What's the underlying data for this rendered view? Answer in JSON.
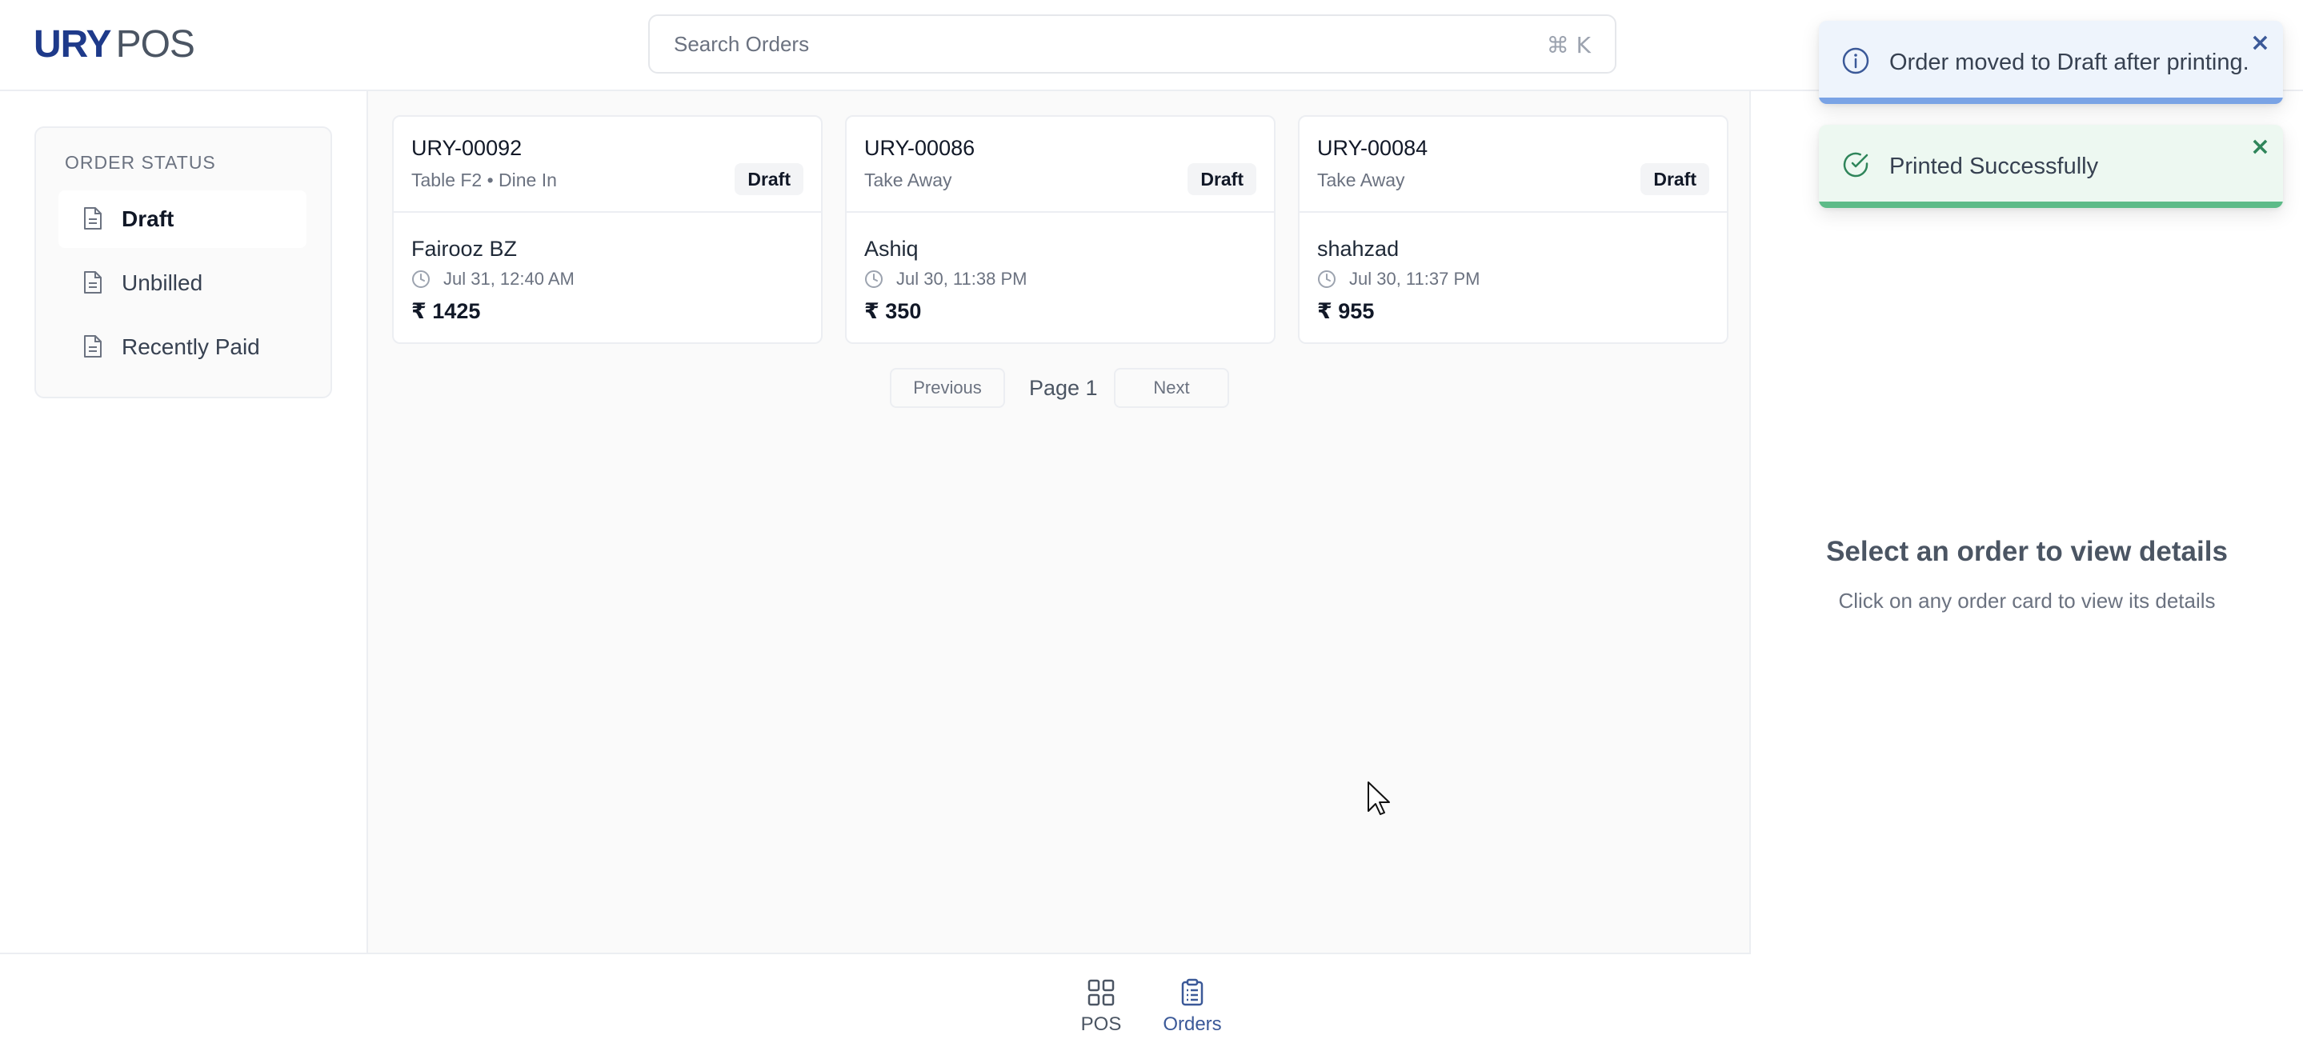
{
  "app": {
    "logo_primary": "URY",
    "logo_secondary": "POS"
  },
  "search": {
    "placeholder": "Search Orders",
    "shortcut": "⌘ K"
  },
  "sidebar": {
    "title": "ORDER STATUS",
    "items": [
      {
        "label": "Draft",
        "active": true
      },
      {
        "label": "Unbilled",
        "active": false
      },
      {
        "label": "Recently Paid",
        "active": false
      }
    ]
  },
  "orders": [
    {
      "id": "URY-00092",
      "sub": "Table F2 • Dine In",
      "status": "Draft",
      "customer": "Fairooz BZ",
      "time": "Jul 31, 12:40 AM",
      "amount": "₹ 1425"
    },
    {
      "id": "URY-00086",
      "sub": "Take Away",
      "status": "Draft",
      "customer": "Ashiq",
      "time": "Jul 30, 11:38 PM",
      "amount": "₹ 350"
    },
    {
      "id": "URY-00084",
      "sub": "Take Away",
      "status": "Draft",
      "customer": "shahzad",
      "time": "Jul 30, 11:37 PM",
      "amount": "₹ 955"
    }
  ],
  "pagination": {
    "previous": "Previous",
    "page": "Page 1",
    "next": "Next"
  },
  "bottom_nav": [
    {
      "label": "POS",
      "icon": "grid-icon",
      "active": false
    },
    {
      "label": "Orders",
      "icon": "clipboard-icon",
      "active": true
    }
  ],
  "detail": {
    "title": "Select an order to view details",
    "subtitle": "Click on any order card to view its details"
  },
  "toasts": [
    {
      "type": "info",
      "message": "Order moved to Draft after printing.",
      "close": "×",
      "progress": 1.0
    },
    {
      "type": "success",
      "message": "Printed Successfully",
      "close": "×",
      "progress": 1.0
    }
  ],
  "colors": {
    "brand": "#1e3a8a",
    "accent": "#3b5bdb",
    "info": "#3b5998",
    "success": "#2f855a"
  }
}
